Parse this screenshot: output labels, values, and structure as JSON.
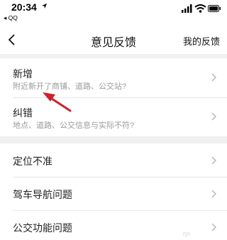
{
  "status": {
    "time": "20:34",
    "back_app": "◂ QQ"
  },
  "nav": {
    "title": "意见反馈",
    "right_link": "我的反馈"
  },
  "group1": [
    {
      "title": "新增",
      "subtitle": "附近新开了商铺、道路、公交站?"
    },
    {
      "title": "纠错",
      "subtitle": "地点、道路、公交信息与实际不符?"
    }
  ],
  "group2": [
    {
      "title": "定位不准"
    },
    {
      "title": "驾车导航问题"
    },
    {
      "title": "公交功能问题"
    }
  ],
  "watermark": "ŋn",
  "colors": {
    "background": "#f0f0f0",
    "card": "#ffffff",
    "annotation_arrow": "#d0202a",
    "chevron": "#b4b4b4"
  },
  "icons": [
    "location-arrow-icon",
    "signal-icon",
    "wifi-icon",
    "battery-icon",
    "back-chevron-icon",
    "chevron-right-icon"
  ]
}
